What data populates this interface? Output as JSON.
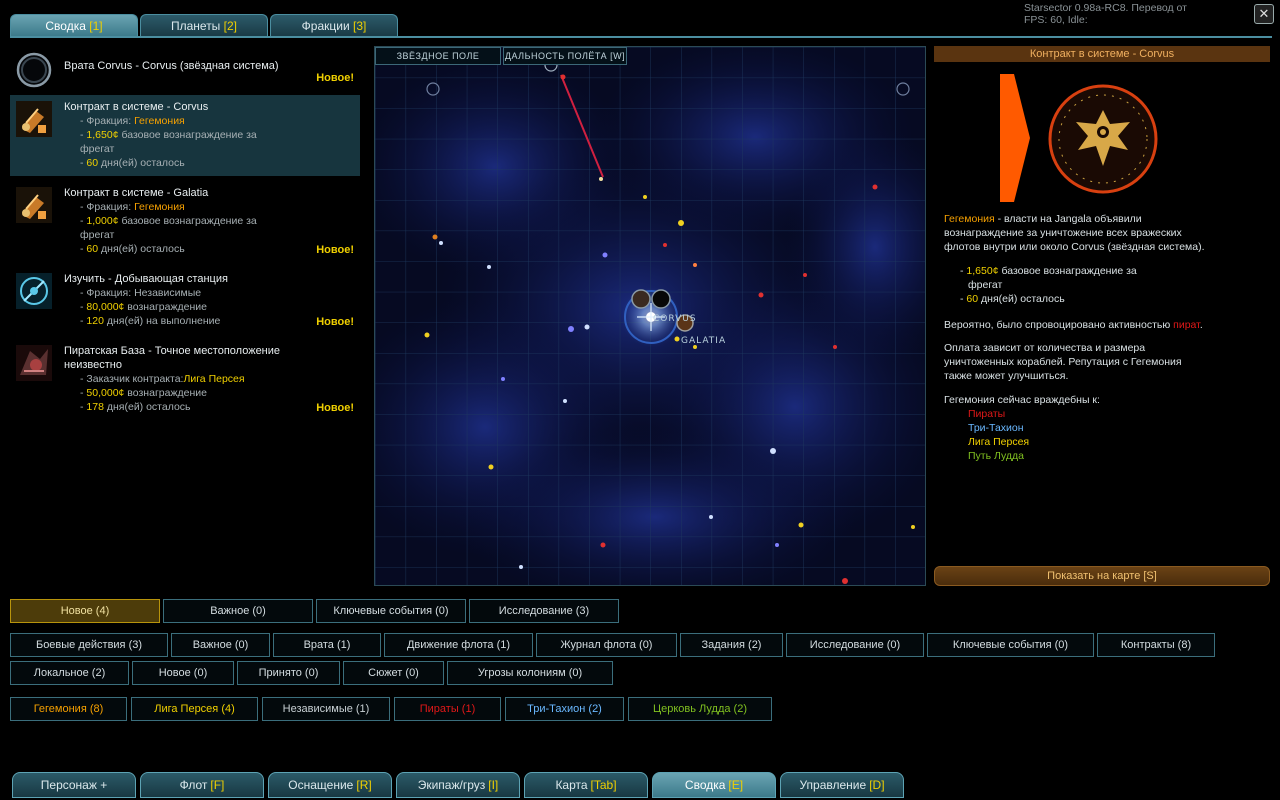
{
  "top_tabs": [
    {
      "label": "Сводка",
      "key": "[1]"
    },
    {
      "label": "Планеты",
      "key": "[2]"
    },
    {
      "label": "Фракции",
      "key": "[3]"
    }
  ],
  "version": "Starsector 0.98a-RC8. Перевод от ",
  "fps": "FPS:  60, Idle: ",
  "intel": [
    {
      "title": "Врата Corvus - Corvus (звёздная система)",
      "badge": "Новое!",
      "icon": "gate-icon"
    },
    {
      "title": "Контракт в системе  - Corvus",
      "faction_label": "- Фракция: ",
      "faction": "Гегемония",
      "reward_value": "1,650¢",
      "reward_text": " базовое вознаграждение за",
      "reward_text2": "фрегат",
      "days_value": "60",
      "days_text": " дня(ей) осталось",
      "icon": "bounty-icon"
    },
    {
      "title": "Контракт в системе  - Galatia",
      "faction_label": "- Фракция: ",
      "faction": "Гегемония",
      "reward_value": "1,000¢",
      "reward_text": " базовое вознаграждение за",
      "reward_text2": "фрегат",
      "days_value": "60",
      "days_text": " дня(ей) осталось",
      "badge": "Новое!",
      "icon": "bounty-icon"
    },
    {
      "title": "Изучить - Добывающая станция",
      "faction_label": "- Фракция: ",
      "faction": "Независимые",
      "reward_value": "80,000¢",
      "reward_text": " вознаграждение",
      "days_value": "120",
      "days_text": " дня(ей) на выполнение",
      "badge": "Новое!",
      "icon": "survey-icon"
    },
    {
      "title": "Пиратская База - Точное местоположение",
      "title2": "неизвестно",
      "faction_label": "- Заказчик контракта:",
      "faction": "Лига Персея",
      "reward_value": "50,000¢",
      "reward_text": " вознаграждение",
      "days_value": "178",
      "days_text": " дня(ей) осталось",
      "badge": "Новое!",
      "icon": "pirate-base-icon"
    }
  ],
  "map": {
    "tab_starfield": "ЗВЁЗДНОЕ ПОЛЕ",
    "tab_range": "ДАЛЬНОСТЬ ПОЛЁТА [W]",
    "label_corvus": "CORVUS",
    "label_galatia": "GALATIA"
  },
  "right": {
    "header": "Контракт в системе  - Corvus",
    "desc_faction": "Гегемония",
    "desc_1": " - власти на Jangala объявили",
    "desc_2": "вознаграждение за уничтожение всех вражеских",
    "desc_3": "флотов внутри или около Corvus (звёздная система).",
    "reward_value": "1,650¢",
    "reward_text": " базовое вознаграждение за",
    "reward_text2": "фрегат",
    "days_value": "60",
    "days_text": " дня(ей) осталось",
    "cause_1": "Вероятно, было спровоцировано активностью ",
    "cause_pirate": "пират",
    "cause_end": ".",
    "pay_1": "Оплата зависит от количества и размера",
    "pay_2": "уничтоженных кораблей. Репутация с Гегемония",
    "pay_3": "также может улучшиться.",
    "hostile_title": "Гегемония сейчас враждебны к:",
    "hostile": [
      {
        "name": "Пираты",
        "color": "#e01818"
      },
      {
        "name": "Три-Тахион",
        "color": "#6ab8ff"
      },
      {
        "name": "Лига Персея",
        "color": "#f0d000"
      },
      {
        "name": "Путь Лудда",
        "color": "#80c020"
      }
    ],
    "show_on_map": "Показать на карте [S]"
  },
  "filters_row1": [
    "Новое (4)",
    "Важное (0)",
    "Ключевые события (0)",
    "Исследование (3)"
  ],
  "filters_row2": [
    "Боевые действия (3)",
    "Важное (0)",
    "Врата (1)",
    "Движение флота (1)",
    "Журнал флота (0)",
    "Задания (2)",
    "Исследование (0)",
    "Ключевые события (0)",
    "Контракты (8)"
  ],
  "filters_row3": [
    "Локальное (2)",
    "Новое (0)",
    "Принято (0)",
    "Сюжет (0)",
    "Угрозы колониям (0)"
  ],
  "filters_row4": [
    {
      "label": "Гегемония (8)",
      "color": "#f5a000"
    },
    {
      "label": "Лига Персея (4)",
      "color": "#f0d000"
    },
    {
      "label": "Независимые (1)",
      "color": "#c8d0d4"
    },
    {
      "label": "Пираты (1)",
      "color": "#e01818"
    },
    {
      "label": "Три-Тахион (2)",
      "color": "#6ab8ff"
    },
    {
      "label": "Церковь Лудда (2)",
      "color": "#80c020"
    }
  ],
  "bottom_nav": [
    {
      "label": "Персонаж +",
      "key": ""
    },
    {
      "label": "Флот",
      "key": "[F]"
    },
    {
      "label": "Оснащение",
      "key": "[R]"
    },
    {
      "label": "Экипаж/груз",
      "key": "[I]"
    },
    {
      "label": "Карта",
      "key": "[Tab]"
    },
    {
      "label": "Сводка",
      "key": "[E]"
    },
    {
      "label": "Управление",
      "key": "[D]"
    }
  ],
  "colors": {
    "accent": "#4b8ea0",
    "highlight": "#f0d000",
    "hegemony": "#f5a000",
    "map_bg": "#05081a"
  }
}
